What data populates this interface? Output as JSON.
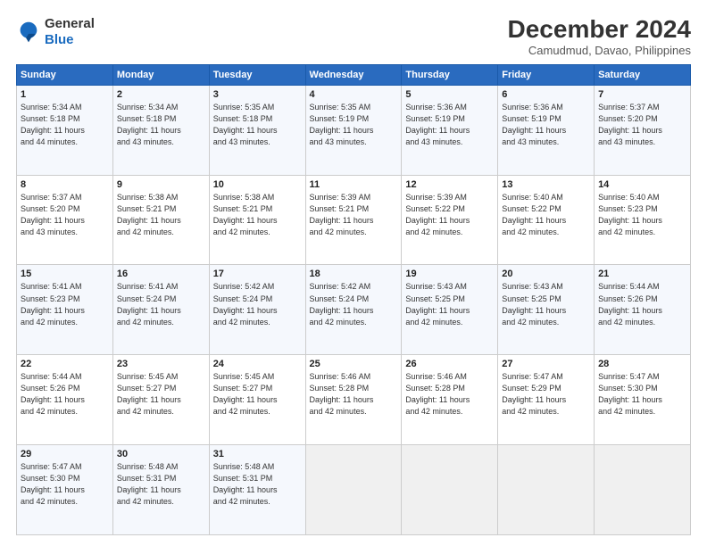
{
  "logo": {
    "line1": "General",
    "line2": "Blue"
  },
  "header": {
    "title": "December 2024",
    "subtitle": "Camudmud, Davao, Philippines"
  },
  "weekdays": [
    "Sunday",
    "Monday",
    "Tuesday",
    "Wednesday",
    "Thursday",
    "Friday",
    "Saturday"
  ],
  "weeks": [
    [
      {
        "day": "1",
        "info": "Sunrise: 5:34 AM\nSunset: 5:18 PM\nDaylight: 11 hours\nand 44 minutes."
      },
      {
        "day": "2",
        "info": "Sunrise: 5:34 AM\nSunset: 5:18 PM\nDaylight: 11 hours\nand 43 minutes."
      },
      {
        "day": "3",
        "info": "Sunrise: 5:35 AM\nSunset: 5:18 PM\nDaylight: 11 hours\nand 43 minutes."
      },
      {
        "day": "4",
        "info": "Sunrise: 5:35 AM\nSunset: 5:19 PM\nDaylight: 11 hours\nand 43 minutes."
      },
      {
        "day": "5",
        "info": "Sunrise: 5:36 AM\nSunset: 5:19 PM\nDaylight: 11 hours\nand 43 minutes."
      },
      {
        "day": "6",
        "info": "Sunrise: 5:36 AM\nSunset: 5:19 PM\nDaylight: 11 hours\nand 43 minutes."
      },
      {
        "day": "7",
        "info": "Sunrise: 5:37 AM\nSunset: 5:20 PM\nDaylight: 11 hours\nand 43 minutes."
      }
    ],
    [
      {
        "day": "8",
        "info": "Sunrise: 5:37 AM\nSunset: 5:20 PM\nDaylight: 11 hours\nand 43 minutes."
      },
      {
        "day": "9",
        "info": "Sunrise: 5:38 AM\nSunset: 5:21 PM\nDaylight: 11 hours\nand 42 minutes."
      },
      {
        "day": "10",
        "info": "Sunrise: 5:38 AM\nSunset: 5:21 PM\nDaylight: 11 hours\nand 42 minutes."
      },
      {
        "day": "11",
        "info": "Sunrise: 5:39 AM\nSunset: 5:21 PM\nDaylight: 11 hours\nand 42 minutes."
      },
      {
        "day": "12",
        "info": "Sunrise: 5:39 AM\nSunset: 5:22 PM\nDaylight: 11 hours\nand 42 minutes."
      },
      {
        "day": "13",
        "info": "Sunrise: 5:40 AM\nSunset: 5:22 PM\nDaylight: 11 hours\nand 42 minutes."
      },
      {
        "day": "14",
        "info": "Sunrise: 5:40 AM\nSunset: 5:23 PM\nDaylight: 11 hours\nand 42 minutes."
      }
    ],
    [
      {
        "day": "15",
        "info": "Sunrise: 5:41 AM\nSunset: 5:23 PM\nDaylight: 11 hours\nand 42 minutes."
      },
      {
        "day": "16",
        "info": "Sunrise: 5:41 AM\nSunset: 5:24 PM\nDaylight: 11 hours\nand 42 minutes."
      },
      {
        "day": "17",
        "info": "Sunrise: 5:42 AM\nSunset: 5:24 PM\nDaylight: 11 hours\nand 42 minutes."
      },
      {
        "day": "18",
        "info": "Sunrise: 5:42 AM\nSunset: 5:24 PM\nDaylight: 11 hours\nand 42 minutes."
      },
      {
        "day": "19",
        "info": "Sunrise: 5:43 AM\nSunset: 5:25 PM\nDaylight: 11 hours\nand 42 minutes."
      },
      {
        "day": "20",
        "info": "Sunrise: 5:43 AM\nSunset: 5:25 PM\nDaylight: 11 hours\nand 42 minutes."
      },
      {
        "day": "21",
        "info": "Sunrise: 5:44 AM\nSunset: 5:26 PM\nDaylight: 11 hours\nand 42 minutes."
      }
    ],
    [
      {
        "day": "22",
        "info": "Sunrise: 5:44 AM\nSunset: 5:26 PM\nDaylight: 11 hours\nand 42 minutes."
      },
      {
        "day": "23",
        "info": "Sunrise: 5:45 AM\nSunset: 5:27 PM\nDaylight: 11 hours\nand 42 minutes."
      },
      {
        "day": "24",
        "info": "Sunrise: 5:45 AM\nSunset: 5:27 PM\nDaylight: 11 hours\nand 42 minutes."
      },
      {
        "day": "25",
        "info": "Sunrise: 5:46 AM\nSunset: 5:28 PM\nDaylight: 11 hours\nand 42 minutes."
      },
      {
        "day": "26",
        "info": "Sunrise: 5:46 AM\nSunset: 5:28 PM\nDaylight: 11 hours\nand 42 minutes."
      },
      {
        "day": "27",
        "info": "Sunrise: 5:47 AM\nSunset: 5:29 PM\nDaylight: 11 hours\nand 42 minutes."
      },
      {
        "day": "28",
        "info": "Sunrise: 5:47 AM\nSunset: 5:30 PM\nDaylight: 11 hours\nand 42 minutes."
      }
    ],
    [
      {
        "day": "29",
        "info": "Sunrise: 5:47 AM\nSunset: 5:30 PM\nDaylight: 11 hours\nand 42 minutes."
      },
      {
        "day": "30",
        "info": "Sunrise: 5:48 AM\nSunset: 5:31 PM\nDaylight: 11 hours\nand 42 minutes."
      },
      {
        "day": "31",
        "info": "Sunrise: 5:48 AM\nSunset: 5:31 PM\nDaylight: 11 hours\nand 42 minutes."
      },
      {
        "day": "",
        "info": ""
      },
      {
        "day": "",
        "info": ""
      },
      {
        "day": "",
        "info": ""
      },
      {
        "day": "",
        "info": ""
      }
    ]
  ]
}
